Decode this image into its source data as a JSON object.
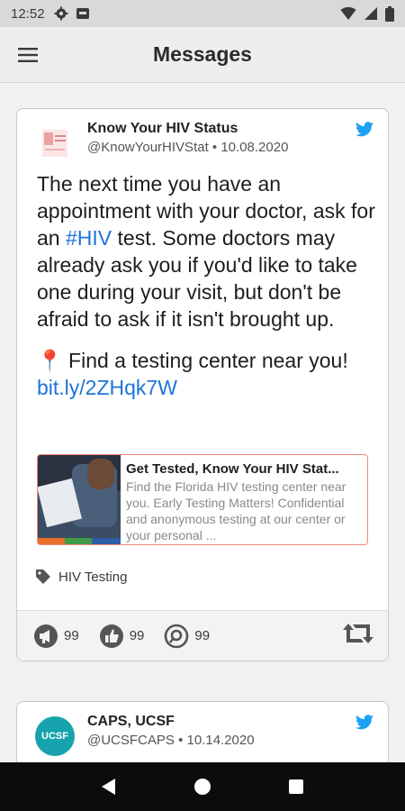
{
  "status_bar": {
    "time": "12:52",
    "left_icons": [
      "gear-icon",
      "notification-box-icon"
    ],
    "right_icons": [
      "wifi-icon",
      "signal-icon",
      "battery-icon"
    ]
  },
  "app_bar": {
    "title": "Messages",
    "menu_icon": "hamburger-menu-icon"
  },
  "posts": [
    {
      "author_name": "Know Your HIV Status",
      "handle": "@KnowYourHIVStat",
      "separator": " • ",
      "date": "10.08.2020",
      "source_icon": "twitter-icon",
      "text_part1": "The next time you have an appointment with your doctor, ask for an ",
      "hashtag": "#HIV",
      "text_part2": " test. Some doctors may already ask you if you'd like to take one during your visit, but don't be afraid to ask if it isn't brought up.",
      "pin_emoji": "📍",
      "text_part3": " Find a testing center near you! ",
      "short_link": "bit.ly/2ZHqk7W",
      "link_preview": {
        "title": "Get Tested, Know Your HIV Stat...",
        "description": "Find the Florida HIV testing center near you. Early Testing Matters! Confidential and anonymous testing at our center or your personal ..."
      },
      "tag": "HIV Testing",
      "actions": {
        "megaphone_count": "99",
        "thumbs_up_count": "99",
        "pin_count": "99"
      }
    },
    {
      "author_name": "CAPS, UCSF",
      "handle": "@UCSFCAPS",
      "separator": " • ",
      "date": "10.14.2020",
      "avatar_text": "UCSF",
      "source_icon": "twitter-icon"
    }
  ],
  "colors": {
    "link": "#1d74d8",
    "twitter": "#1da1f2",
    "caps_avatar": "#17a3ad",
    "preview_border": "#f08a7a"
  }
}
